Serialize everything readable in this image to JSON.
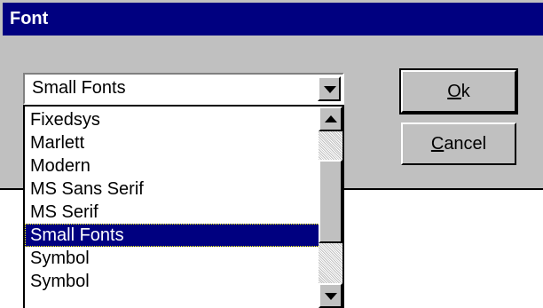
{
  "window": {
    "title": "Font"
  },
  "combo": {
    "value": "Small Fonts"
  },
  "list": {
    "items": [
      "Fixedsys",
      "Marlett",
      "Modern",
      "MS Sans Serif",
      "MS Serif",
      "Small Fonts",
      "Symbol",
      "Symbol"
    ],
    "selected": "Small Fonts"
  },
  "buttons": {
    "ok_mnemonic": "O",
    "ok_rest": "k",
    "cancel_mnemonic": "C",
    "cancel_rest": "ancel"
  },
  "colors": {
    "titlebar": "#000080",
    "face": "#c0c0c0",
    "selection": "#000080"
  }
}
